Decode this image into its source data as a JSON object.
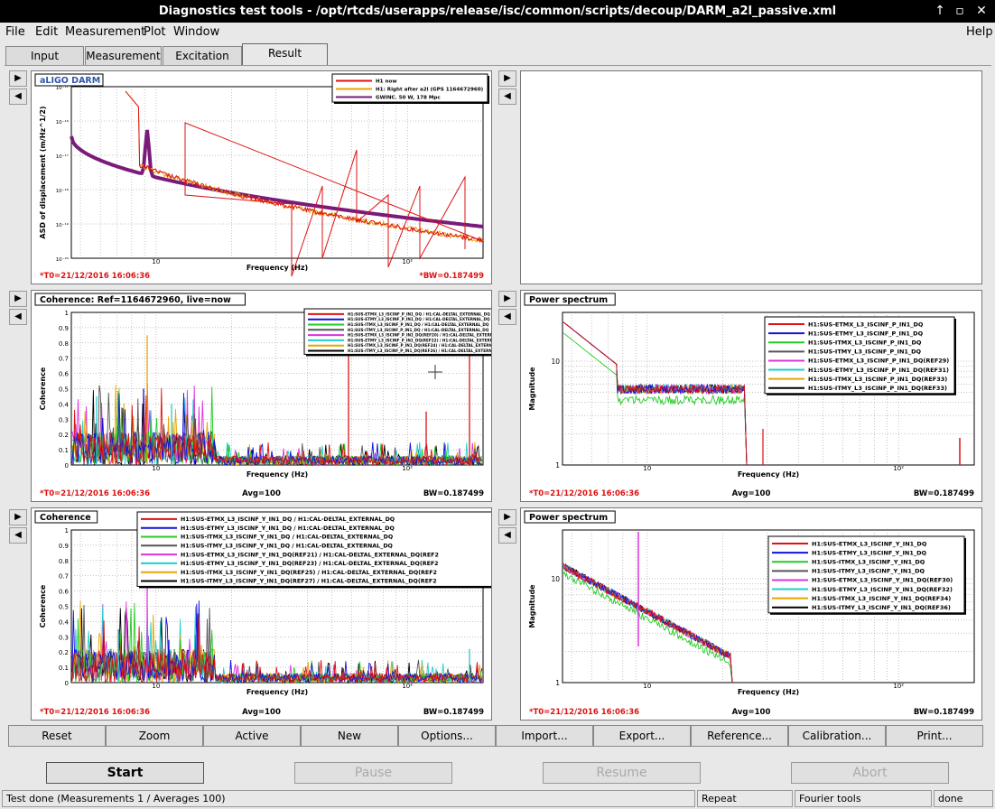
{
  "window": {
    "title": "Diagnostics test tools - /opt/rtcds/userapps/release/isc/common/scripts/decoup/DARM_a2l_passive.xml",
    "buttons": {
      "up": "↑",
      "restore": "▫",
      "close": "✕"
    }
  },
  "menu": {
    "file": "File",
    "edit": "Edit",
    "measurement": "Measurement",
    "plot": "Plot",
    "window": "Window",
    "help": "Help"
  },
  "tabs": {
    "input": "Input",
    "measurement": "Measurement",
    "excitation": "Excitation",
    "result": "Result"
  },
  "colors": {
    "red": "#dd1111",
    "blue": "#1111dd",
    "green": "#22cc22",
    "darkgray": "#555555",
    "magenta": "#dd33dd",
    "cyan": "#22cccc",
    "orange": "#e8a500",
    "black": "#000000",
    "purple": "#7a1a7a"
  },
  "panels": [
    {
      "title": "aLIGO DARM",
      "xlabel": "Frequency (Hz)",
      "ylabel": "ASD of displacement (m/Hz^1/2)",
      "t0": "*T0=21/12/2016 16:06:36",
      "avg": "",
      "bw": "*BW=0.187499",
      "legend": [
        "H1 now",
        "H1: Right after a2l (GPS 1164672960)",
        "GWINC. 50 W, 178 Mpc"
      ],
      "yticks": [
        "10⁻¹¹",
        "10⁻¹⁶",
        "10⁻¹⁷",
        "10⁻¹⁸",
        "10⁻¹⁹",
        "10⁻²⁰"
      ],
      "xticks": [
        "10",
        "10²"
      ]
    },
    {
      "title": "Coherence: Ref=1164672960, live=now",
      "xlabel": "Frequency (Hz)",
      "ylabel": "Coherence",
      "t0": "*T0=21/12/2016 16:06:36",
      "avg": "Avg=100",
      "bw": "BW=0.187499",
      "legend": [
        "H1:SUS-ETMX_L3_ISCINF_P_IN1_DQ / H1:CAL-DELTAL_EXTERNAL_DQ",
        "H1:SUS-ETMY_L3_ISCINF_P_IN1_DQ / H1:CAL-DELTAL_EXTERNAL_DQ",
        "H1:SUS-ITMX_L3_ISCINF_P_IN1_DQ / H1:CAL-DELTAL_EXTERNAL_DQ",
        "H1:SUS-ITMY_L3_ISCINF_P_IN1_DQ / H1:CAL-DELTAL_EXTERNAL_DQ",
        "H1:SUS-ETMX_L3_ISCINF_P_IN1_DQ(REF20) / H1:CAL-DELTAL_EXTERNAL",
        "H1:SUS-ETMY_L3_ISCINF_P_IN1_DQ(REF22) / H1:CAL-DELTAL_EXTERNAL",
        "H1:SUS-ITMX_L3_ISCINF_P_IN1_DQ(REF24) / H1:CAL-DELTAL_EXTERNAL",
        "H1:SUS-ITMY_L3_ISCINF_P_IN1_DQ(REF26) / H1:CAL-DELTAL_EXTERNAL"
      ],
      "yticks": [
        "0",
        "0.1",
        "0.2",
        "0.3",
        "0.4",
        "0.5",
        "0.6",
        "0.7",
        "0.8",
        "0.9",
        "1"
      ],
      "xticks": [
        "10",
        "10²"
      ]
    },
    {
      "title": "Power spectrum",
      "xlabel": "Frequency (Hz)",
      "ylabel": "Magnitude",
      "t0": "*T0=21/12/2016 16:06:36",
      "avg": "Avg=100",
      "bw": "BW=0.187499",
      "legend": [
        "H1:SUS-ETMX_L3_ISCINF_P_IN1_DQ",
        "H1:SUS-ETMY_L3_ISCINF_P_IN1_DQ",
        "H1:SUS-ITMX_L3_ISCINF_P_IN1_DQ",
        "H1:SUS-ITMY_L3_ISCINF_P_IN1_DQ",
        "H1:SUS-ETMX_L3_ISCINF_P_IN1_DQ(REF29)",
        "H1:SUS-ETMY_L3_ISCINF_P_IN1_DQ(REF31)",
        "H1:SUS-ITMX_L3_ISCINF_P_IN1_DQ(REF33)",
        "H1:SUS-ITMY_L3_ISCINF_P_IN1_DQ(REF33)"
      ],
      "yticks": [
        "10",
        "1"
      ],
      "xticks": [
        "10",
        "10²"
      ]
    },
    {
      "title": "Coherence",
      "xlabel": "Frequency (Hz)",
      "ylabel": "Coherence",
      "t0": "*T0=21/12/2016 16:06:36",
      "avg": "Avg=100",
      "bw": "BW=0.187499",
      "legend": [
        "H1:SUS-ETMX_L3_ISCINF_Y_IN1_DQ / H1:CAL-DELTAL_EXTERNAL_DQ",
        "H1:SUS-ETMY_L3_ISCINF_Y_IN1_DQ / H1:CAL-DELTAL_EXTERNAL_DQ",
        "H1:SUS-ITMX_L3_ISCINF_Y_IN1_DQ / H1:CAL-DELTAL_EXTERNAL_DQ",
        "H1:SUS-ITMY_L3_ISCINF_Y_IN1_DQ / H1:CAL-DELTAL_EXTERNAL_DQ",
        "H1:SUS-ETMX_L3_ISCINF_Y_IN1_DQ(REF21) / H1:CAL-DELTAL_EXTERNAL_DQ(REF2",
        "H1:SUS-ETMY_L3_ISCINF_Y_IN1_DQ(REF23) / H1:CAL-DELTAL_EXTERNAL_DQ(REF2",
        "H1:SUS-ITMX_L3_ISCINF_Y_IN1_DQ(REF25) / H1:CAL-DELTAL_EXTERNAL_DQ(REF2",
        "H1:SUS-ITMY_L3_ISCINF_Y_IN1_DQ(REF27) / H1:CAL-DELTAL_EXTERNAL_DQ(REF2"
      ],
      "yticks": [
        "0",
        "0.1",
        "0.2",
        "0.3",
        "0.4",
        "0.5",
        "0.6",
        "0.7",
        "0.8",
        "0.9",
        "1"
      ],
      "xticks": [
        "10",
        "10²"
      ]
    },
    {
      "title": "Power spectrum",
      "xlabel": "Frequency (Hz)",
      "ylabel": "Magnitude",
      "t0": "*T0=21/12/2016 16:06:36",
      "avg": "Avg=100",
      "bw": "BW=0.187499",
      "legend": [
        "H1:SUS-ETMX_L3_ISCINF_Y_IN1_DQ",
        "H1:SUS-ETMY_L3_ISCINF_Y_IN1_DQ",
        "H1:SUS-ITMX_L3_ISCINF_Y_IN1_DQ",
        "H1:SUS-ITMY_L3_ISCINF_Y_IN1_DQ",
        "H1:SUS-ETMX_L3_ISCINF_Y_IN1_DQ(REF30)",
        "H1:SUS-ETMY_L3_ISCINF_Y_IN1_DQ(REF32)",
        "H1:SUS-ITMX_L3_ISCINF_Y_IN1_DQ(REF34)",
        "H1:SUS-ITMY_L3_ISCINF_Y_IN1_DQ(REF36)"
      ],
      "yticks": [
        "10",
        "1"
      ],
      "xticks": [
        "10",
        "10²"
      ]
    }
  ],
  "bottom_buttons": [
    "Reset",
    "Zoom",
    "Active",
    "New",
    "Options...",
    "Import...",
    "Export...",
    "Reference...",
    "Calibration...",
    "Print..."
  ],
  "control_buttons": {
    "start": "Start",
    "pause": "Pause",
    "resume": "Resume",
    "abort": "Abort"
  },
  "status": {
    "message": "Test done (Measurements 1 / Averages 100)",
    "mode": "Repeat",
    "tool": "Fourier tools",
    "state": "done"
  }
}
